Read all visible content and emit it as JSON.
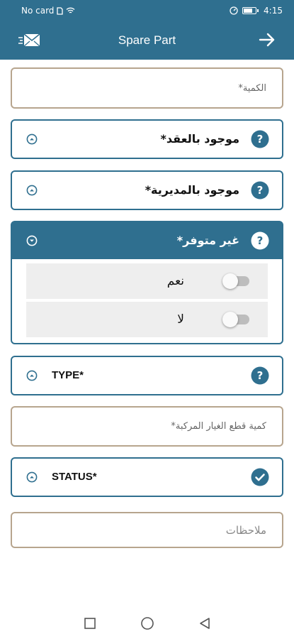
{
  "status_bar": {
    "carrier": "No card",
    "time": "4:15"
  },
  "app_bar": {
    "title": "Spare Part",
    "left_icon": "mail-icon",
    "right_icon": "arrow-forward-icon"
  },
  "form": {
    "quantity_placeholder": "الكمية*",
    "contract_available": {
      "label": "موجود بالعقد*",
      "icon": "help-icon"
    },
    "directorate_available": {
      "label": "موجود بالمديرية*",
      "icon": "help-icon"
    },
    "not_available": {
      "label": "غير متوفر*",
      "icon": "help-icon",
      "options": [
        {
          "label": "نعم",
          "checked": false
        },
        {
          "label": "لا",
          "checked": false
        }
      ]
    },
    "type": {
      "label": "TYPE*",
      "icon": "help-icon"
    },
    "installed_parts_quantity_placeholder": "كمية قطع الغيار المركبة*",
    "status": {
      "label": "STATUS*",
      "icon": "check-circle-icon"
    },
    "notes_placeholder": "ملاحظات"
  },
  "colors": {
    "primary": "#2f6f8f",
    "field_border": "#b7a58e",
    "option_bg": "#eeeeee"
  }
}
